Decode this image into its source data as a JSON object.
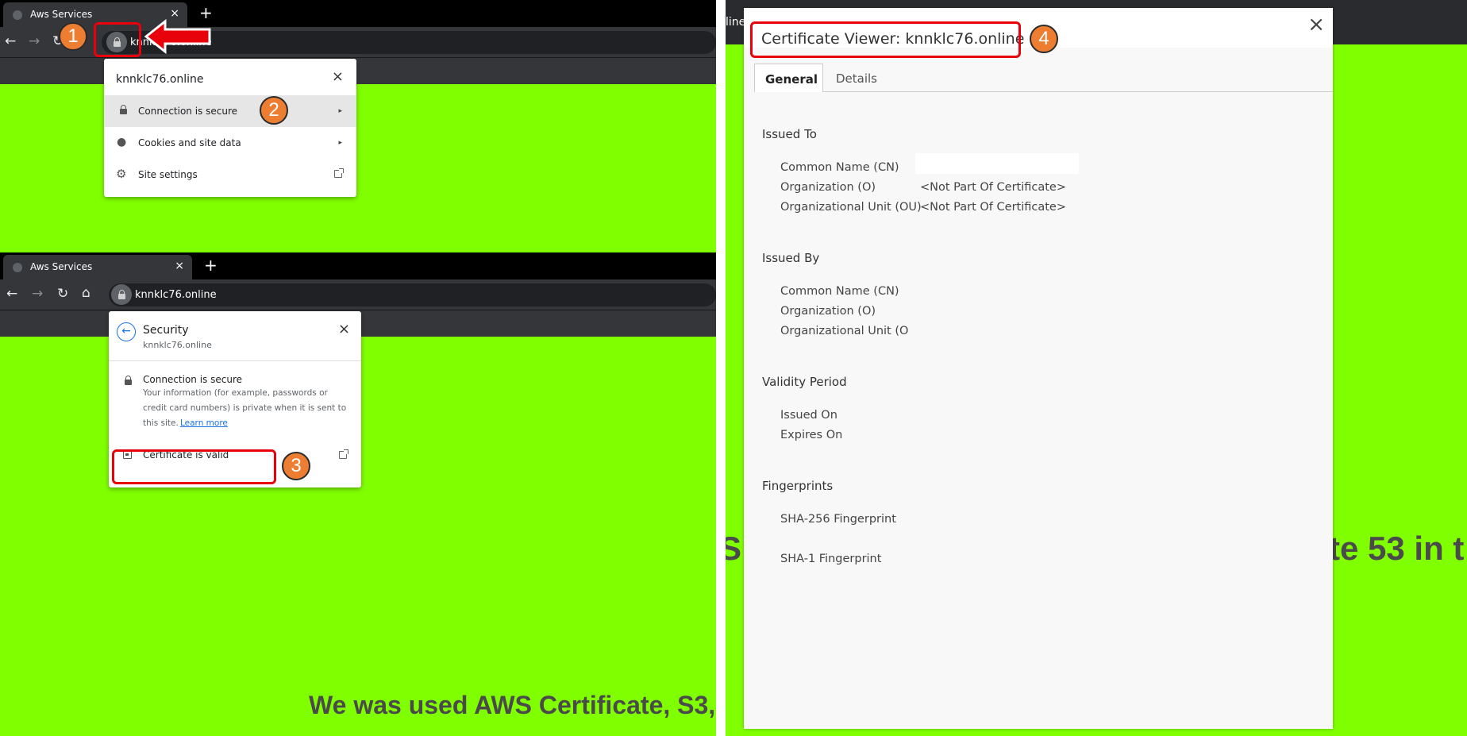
{
  "browser": {
    "tab_title": "Aws Services",
    "new_tab": "+",
    "tab_close": "×",
    "url": "knnklc76.online"
  },
  "popup1": {
    "site": "knnklc76.online",
    "close": "×",
    "items": [
      {
        "label": "Connection is secure",
        "icon": "lock-icon",
        "chevron": "▸"
      },
      {
        "label": "Cookies and site data",
        "icon": "cookie-icon",
        "chevron": "▸"
      },
      {
        "label": "Site settings",
        "icon": "gear-icon"
      }
    ]
  },
  "popup2": {
    "title": "Security",
    "site": "knnklc76.online",
    "close": "×",
    "heading": "Connection is secure",
    "desc_line1": "Your information (for example, passwords or",
    "desc_line2": "credit card numbers) is private when it is sent to",
    "desc_line3": "this site.",
    "learn_more": "Learn more",
    "certificate": "Certificate is valid"
  },
  "annotations": {
    "step1": "1",
    "step2": "2",
    "step3": "3",
    "step4": "4",
    "accent": "#e8000b",
    "badge_color": "#ed7d31"
  },
  "viewer": {
    "title": "Certificate Viewer: knnklc76.online",
    "close": "×",
    "tabs": [
      "General",
      "Details"
    ],
    "issued_to": {
      "heading": "Issued To",
      "fields": [
        "Common Name (CN)",
        "Organization (O)",
        "Organizational Unit (OU)"
      ],
      "values": [
        "",
        "<Not Part Of Certificate>",
        "<Not Part Of Certificate>"
      ]
    },
    "issued_by": {
      "heading": "Issued By",
      "fields": [
        "Common Name (CN)",
        "Organization (O)",
        "Organizational Unit (O"
      ]
    },
    "validity": {
      "heading": "Validity Period",
      "fields": [
        "Issued On",
        "Expires On"
      ]
    },
    "fingerprints": {
      "heading": "Fingerprints",
      "fields": [
        "SHA-256 Fingerprint",
        "SHA-1 Fingerprint"
      ]
    }
  },
  "page": {
    "bottom_text": "We was used AWS Certificate, S3,",
    "right_text_left": "S C",
    "right_text_right": "te 53 in t",
    "behind_tab": "line",
    "green": "#80ff00"
  }
}
